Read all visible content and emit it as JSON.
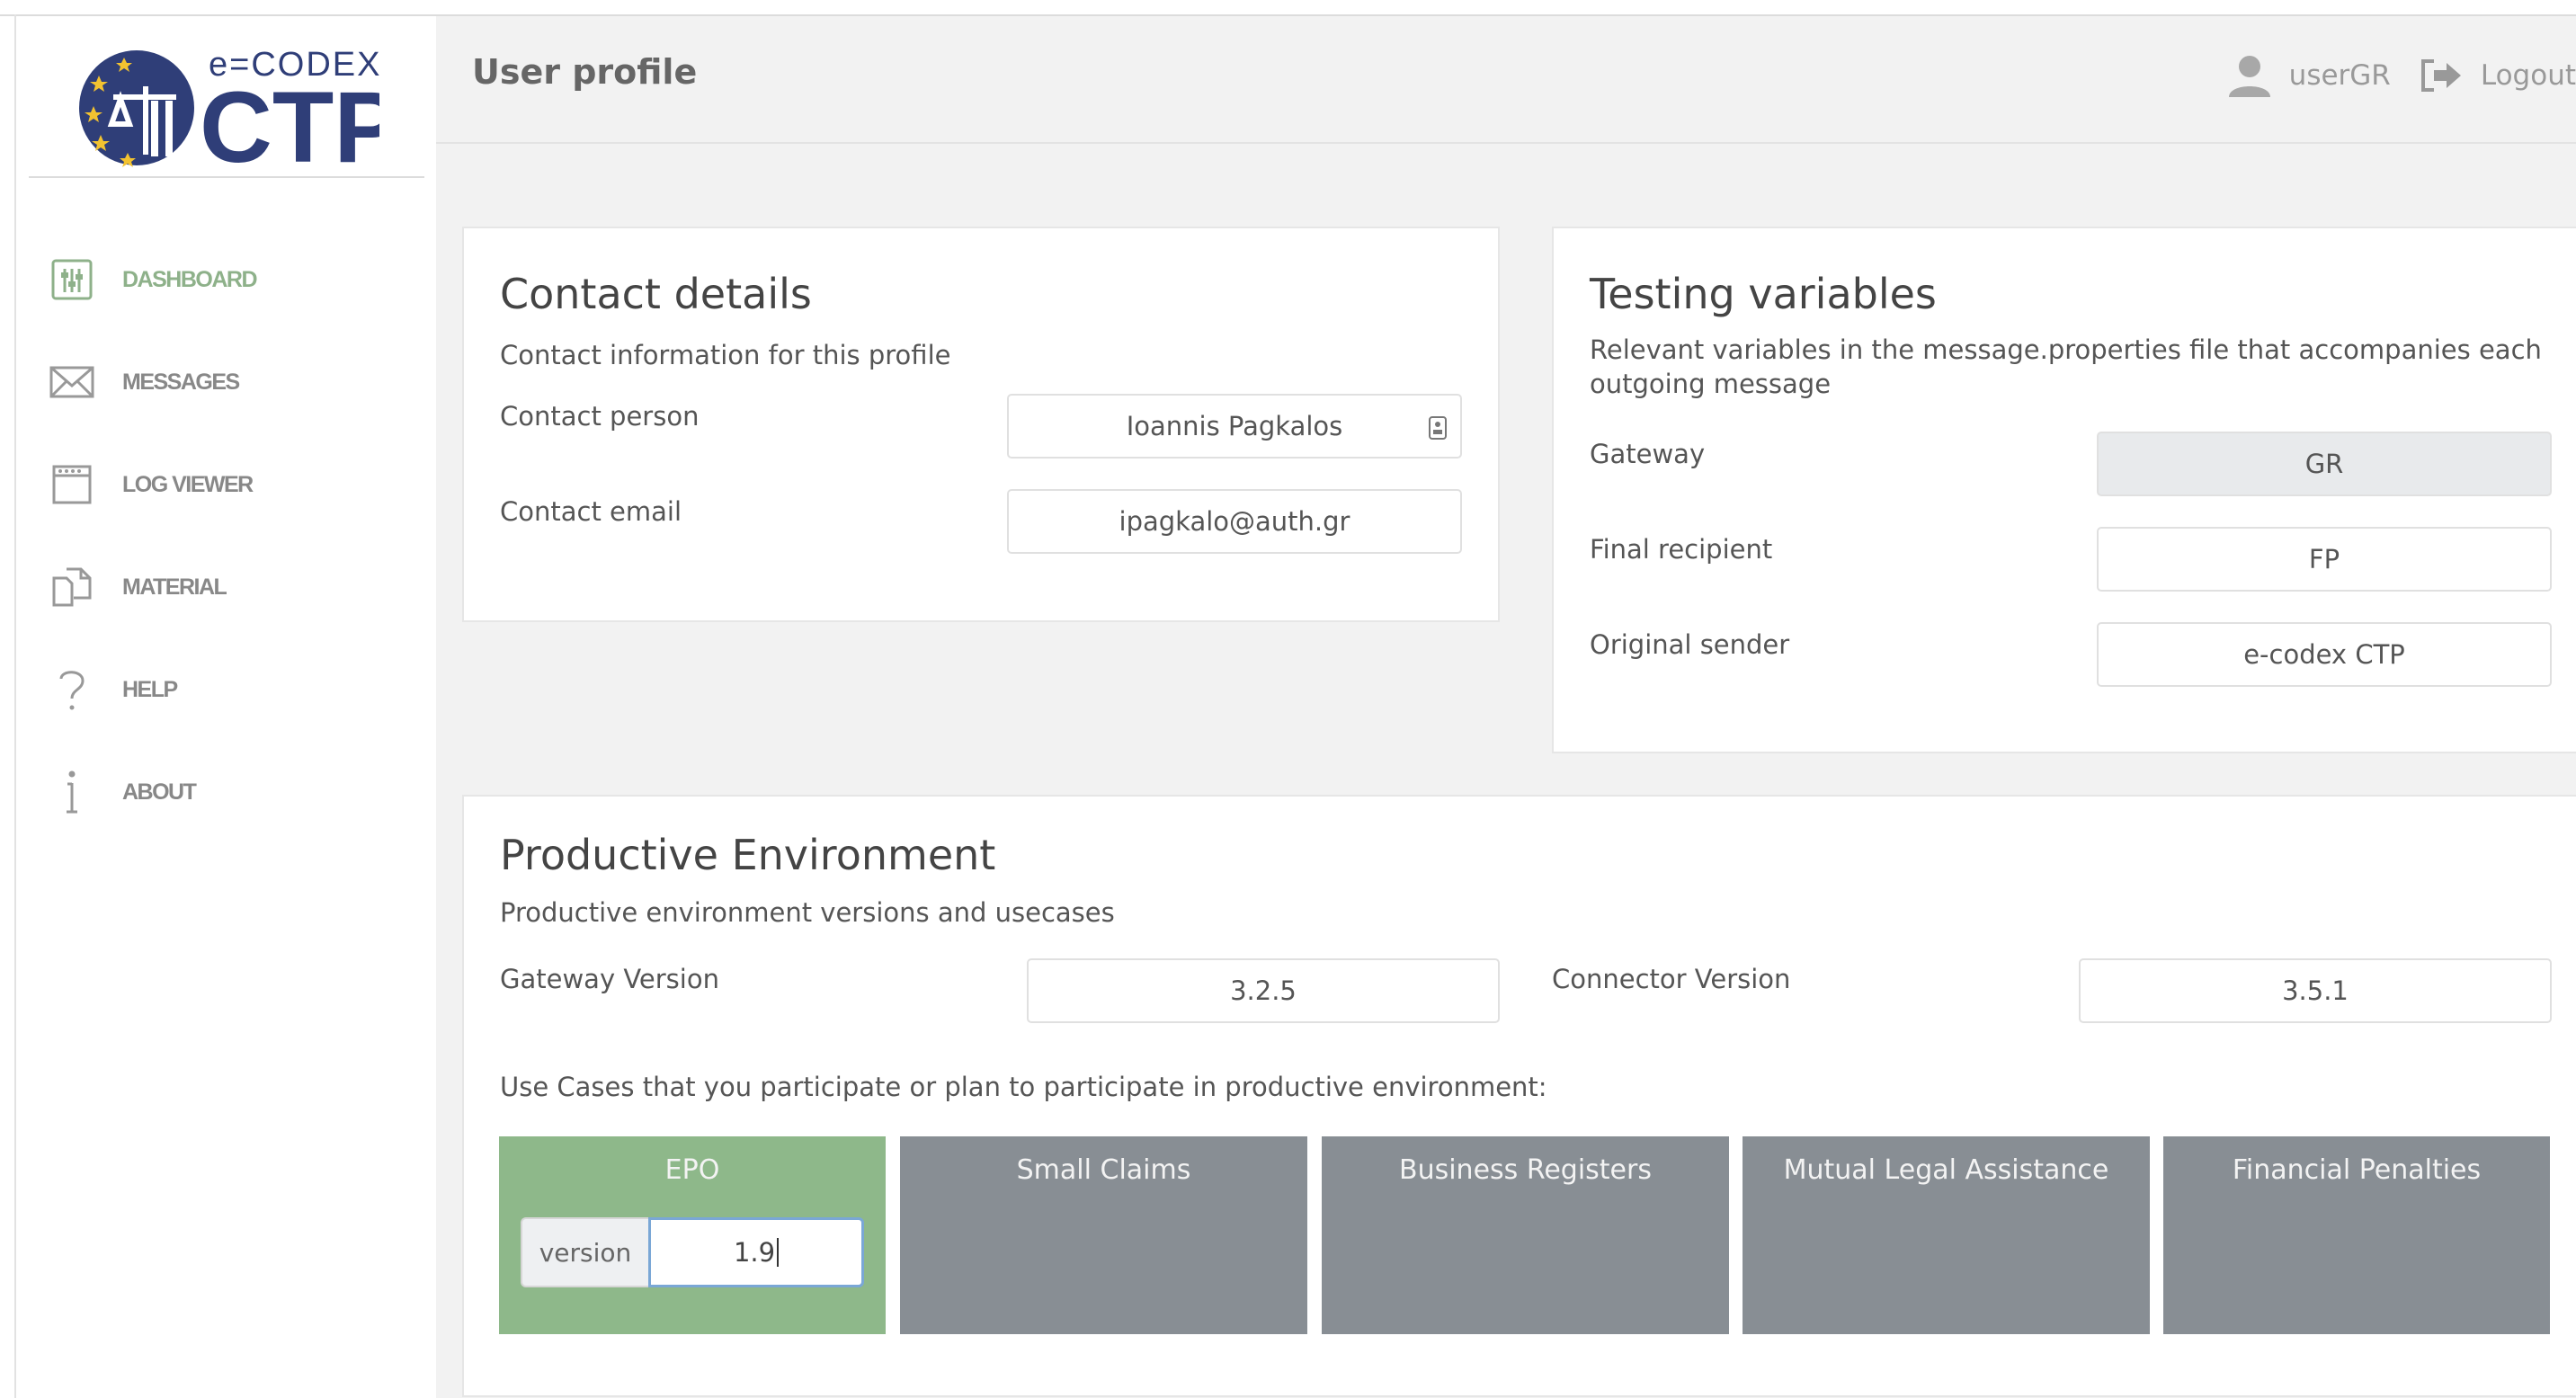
{
  "brand": {
    "top": "e=CODEX",
    "main": "CTP"
  },
  "colors": {
    "accent": "#8eb18a",
    "tile": "#888e94",
    "tile_active": "#8eb88a"
  },
  "sidebar": {
    "items": [
      {
        "label": "DASHBOARD",
        "icon": "sliders-icon",
        "active": true
      },
      {
        "label": "MESSAGES",
        "icon": "envelope-icon"
      },
      {
        "label": "LOG VIEWER",
        "icon": "window-icon"
      },
      {
        "label": "MATERIAL",
        "icon": "documents-icon"
      },
      {
        "label": "HELP",
        "icon": "question-icon"
      },
      {
        "label": "ABOUT",
        "icon": "info-icon"
      }
    ]
  },
  "header": {
    "title": "User profile",
    "user": "userGR",
    "logout": "Logout"
  },
  "contact": {
    "title": "Contact details",
    "subtitle": "Contact information for this profile",
    "person_label": "Contact person",
    "person_value": "Ioannis Pagkalos",
    "email_label": "Contact email",
    "email_value": "ipagkalo@auth.gr"
  },
  "testing": {
    "title": "Testing variables",
    "subtitle_line1": "Relevant variables in the message.properties file that accompanies each",
    "subtitle_line2": "outgoing message",
    "gateway_label": "Gateway",
    "gateway_value": "GR",
    "final_label": "Final recipient",
    "final_value": "FP",
    "sender_label": "Original sender",
    "sender_value": "e-codex CTP"
  },
  "productive": {
    "title": "Productive Environment",
    "subtitle": "Productive environment versions and usecases",
    "gateway_version_label": "Gateway Version",
    "gateway_version_value": "3.2.5",
    "connector_version_label": "Connector Version",
    "connector_version_value": "3.5.1",
    "usecases_label": "Use Cases that you participate or plan to participate in productive environment:",
    "usecases": [
      {
        "label": "EPO",
        "active": true,
        "version_label": "version",
        "version_value": "1.9"
      },
      {
        "label": "Small Claims"
      },
      {
        "label": "Business Registers"
      },
      {
        "label": "Mutual Legal Assistance"
      },
      {
        "label": "Financial Penalties"
      }
    ]
  }
}
